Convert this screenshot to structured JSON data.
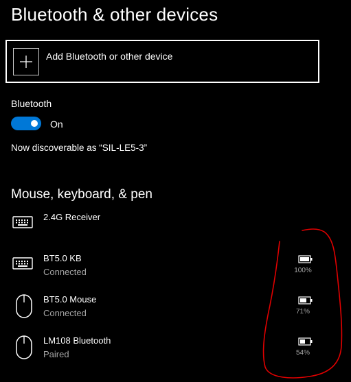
{
  "page": {
    "title": "Bluetooth & other devices"
  },
  "add_device": {
    "label": "Add Bluetooth or other device",
    "icon": "plus-icon"
  },
  "bluetooth": {
    "label": "Bluetooth",
    "toggle_state": "On",
    "enabled": true,
    "discoverable_text": "Now discoverable as “SIL-LE5-3”"
  },
  "section": {
    "heading": "Mouse, keyboard, & pen"
  },
  "devices": [
    {
      "name": "2.4G Receiver",
      "status": "",
      "icon": "keyboard-icon"
    },
    {
      "name": "BT5.0 KB",
      "status": "Connected",
      "icon": "keyboard-icon",
      "battery": "100%"
    },
    {
      "name": "BT5.0 Mouse",
      "status": "Connected",
      "icon": "mouse-icon",
      "battery": "71%"
    },
    {
      "name": "LM108 Bluetooth",
      "status": "Paired",
      "icon": "mouse-icon",
      "battery": "54%"
    }
  ],
  "colors": {
    "background": "#000000",
    "accent": "#0078d7",
    "secondary_text": "#a6a6a6",
    "annotation": "#e00000"
  }
}
